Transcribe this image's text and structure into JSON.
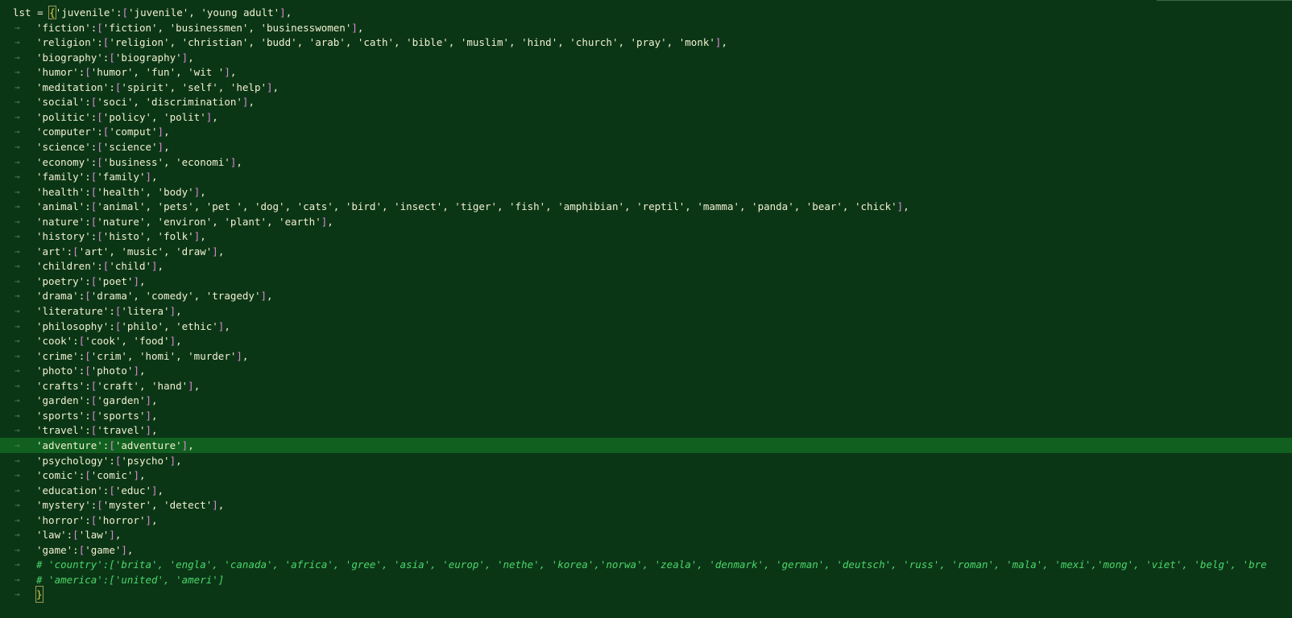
{
  "editor": {
    "variable": "lst",
    "assign": "=",
    "indent_marker": "→",
    "active_line": 29,
    "lines": [
      {
        "key": "'juvenile'",
        "values": "'juvenile', 'young adult'",
        "first": true
      },
      {
        "key": "'fiction'",
        "values": "'fiction', 'businessmen', 'businesswomen'"
      },
      {
        "key": "'religion'",
        "values": "'religion', 'christian', 'budd', 'arab', 'cath', 'bible', 'muslim', 'hind', 'church', 'pray', 'monk'"
      },
      {
        "key": "'biography'",
        "values": "'biography'"
      },
      {
        "key": "'humor'",
        "values": "'humor', 'fun', 'wit '"
      },
      {
        "key": "'meditation'",
        "values": "'spirit', 'self', 'help'"
      },
      {
        "key": "'social'",
        "values": "'soci', 'discrimination'"
      },
      {
        "key": "'politic'",
        "values": "'policy', 'polit'"
      },
      {
        "key": "'computer'",
        "values": "'comput'"
      },
      {
        "key": "'science'",
        "values": "'science'"
      },
      {
        "key": "'economy'",
        "values": "'business', 'economi'"
      },
      {
        "key": "'family'",
        "values": "'family'"
      },
      {
        "key": "'health'",
        "values": "'health', 'body'"
      },
      {
        "key": "'animal'",
        "values": "'animal', 'pets', 'pet ', 'dog', 'cats', 'bird', 'insect', 'tiger', 'fish', 'amphibian', 'reptil', 'mamma', 'panda', 'bear', 'chick'"
      },
      {
        "key": "'nature'",
        "values": "'nature', 'environ', 'plant', 'earth'"
      },
      {
        "key": "'history'",
        "values": "'histo', 'folk'"
      },
      {
        "key": "'art'",
        "values": "'art', 'music', 'draw'"
      },
      {
        "key": "'children'",
        "values": "'child'"
      },
      {
        "key": "'poetry'",
        "values": "'poet'"
      },
      {
        "key": "'drama'",
        "values": "'drama', 'comedy', 'tragedy'"
      },
      {
        "key": "'literature'",
        "values": "'litera'"
      },
      {
        "key": "'philosophy'",
        "values": "'philo', 'ethic'"
      },
      {
        "key": "'cook'",
        "values": "'cook', 'food'"
      },
      {
        "key": "'crime'",
        "values": "'crim', 'homi', 'murder'"
      },
      {
        "key": "'photo'",
        "values": "'photo'"
      },
      {
        "key": "'crafts'",
        "values": "'craft', 'hand'"
      },
      {
        "key": "'garden'",
        "values": "'garden'"
      },
      {
        "key": "'sports'",
        "values": "'sports'"
      },
      {
        "key": "'travel'",
        "values": "'travel'"
      },
      {
        "key": "'adventure'",
        "values": "'adventure'"
      },
      {
        "key": "'psychology'",
        "values": "'psycho'"
      },
      {
        "key": "'comic'",
        "values": "'comic'"
      },
      {
        "key": "'education'",
        "values": "'educ'"
      },
      {
        "key": "'mystery'",
        "values": "'myster', 'detect'"
      },
      {
        "key": "'horror'",
        "values": "'horror'"
      },
      {
        "key": "'law'",
        "values": "'law'"
      },
      {
        "key": "'game'",
        "values": "'game'"
      }
    ],
    "comments": [
      "# 'country':['brita', 'engla', 'canada', 'africa', 'gree', 'asia', 'europ', 'nethe', 'korea','norwa', 'zeala', 'denmark', 'german', 'deutsch', 'russ', 'roman', 'mala', 'mexi','mong', 'viet', 'belg', 'bre",
      "# 'america':['united', 'ameri']"
    ],
    "closing": "}"
  }
}
